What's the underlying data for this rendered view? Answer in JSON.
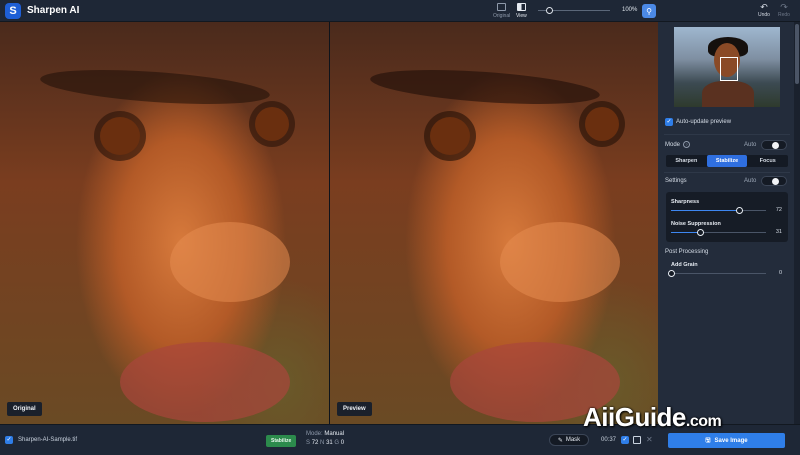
{
  "app": {
    "title": "Sharpen AI",
    "logo_letter": "S"
  },
  "toolbar": {
    "original_label": "Original",
    "view_label": "View",
    "zoom_value": "100%",
    "zoom_fraction": 0.15,
    "undo_label": "Undo",
    "redo_label": "Redo"
  },
  "panes": {
    "left_label": "Original",
    "right_label": "Preview"
  },
  "panel": {
    "auto_update_label": "Auto-update preview",
    "auto_update_checked": true,
    "mode_label": "Mode",
    "mode_auto_label": "Auto",
    "mode_tabs": [
      "Sharpen",
      "Stabilize",
      "Focus"
    ],
    "mode_selected": "Stabilize",
    "settings_label": "Settings",
    "settings_auto_label": "Auto",
    "sharpness": {
      "label": "Sharpness",
      "value": "72",
      "fraction": 0.72
    },
    "noise": {
      "label": "Noise Suppression",
      "value": "31",
      "fraction": 0.31
    },
    "post_processing_label": "Post Processing",
    "grain": {
      "label": "Add Grain",
      "value": "0",
      "fraction": 0.0
    }
  },
  "bottom": {
    "file_name": "Sharpen-AI-Sample.tif",
    "mode_badge": "Stabilize",
    "mode_meta_label": "Mode:",
    "mode_meta_value": "Manual",
    "s_label": "S",
    "s_value": "72",
    "n_label": "N",
    "n_value": "31",
    "g_label": "G",
    "g_value": "0",
    "mask_label": "Mask",
    "time": "00:37",
    "save_label": "Save Image"
  },
  "watermark": {
    "main": "AiiGuide",
    "suffix": ".com"
  },
  "colors": {
    "accent": "#2f7ee8",
    "badge_green": "#2c8b4c",
    "panel_bg": "#232c3b"
  }
}
